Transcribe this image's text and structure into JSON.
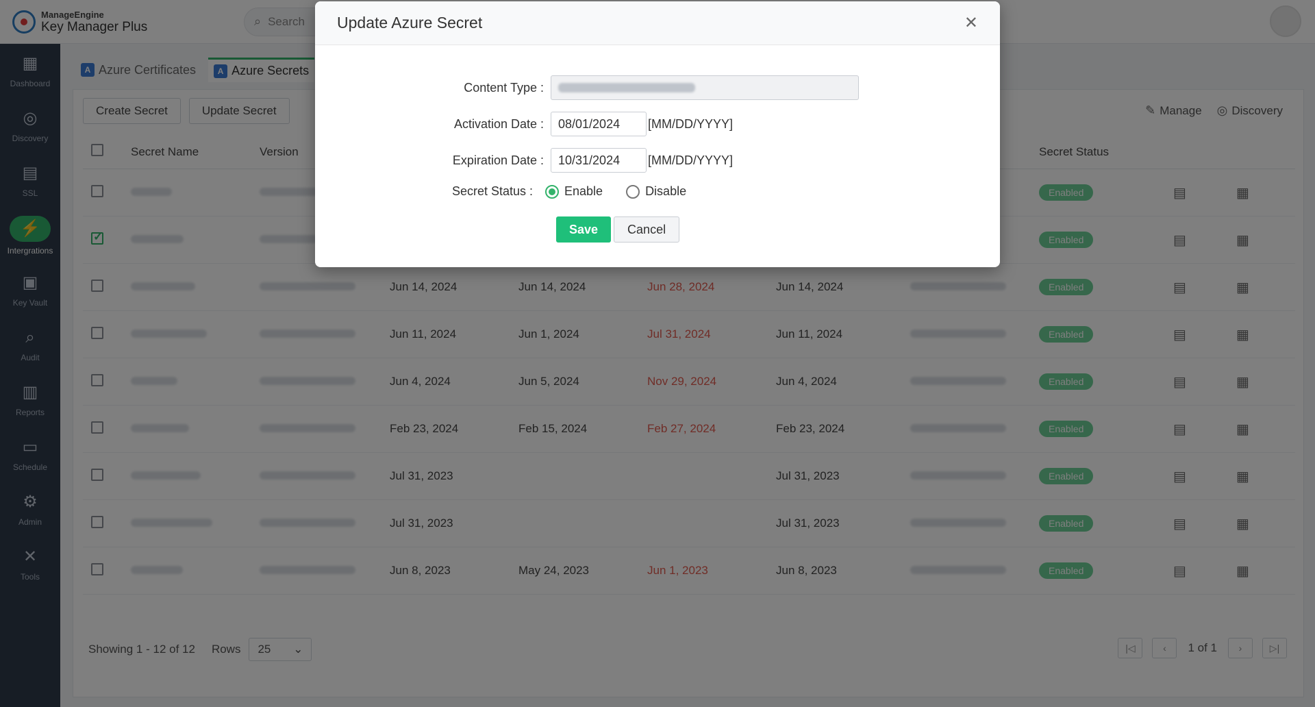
{
  "brand": {
    "small": "ManageEngine",
    "big": "Key Manager Plus"
  },
  "search": {
    "placeholder": "Search"
  },
  "sidebar": {
    "items": [
      {
        "label": "Dashboard",
        "icon": "dashboard-icon"
      },
      {
        "label": "Discovery",
        "icon": "compass-icon"
      },
      {
        "label": "SSL",
        "icon": "certificate-icon"
      },
      {
        "label": "Intergrations",
        "icon": "plug-icon",
        "active": true
      },
      {
        "label": "Key Vault",
        "icon": "vault-icon"
      },
      {
        "label": "Audit",
        "icon": "audit-icon"
      },
      {
        "label": "Reports",
        "icon": "reports-icon"
      },
      {
        "label": "Schedule",
        "icon": "calendar-icon"
      },
      {
        "label": "Admin",
        "icon": "gear-icon"
      },
      {
        "label": "Tools",
        "icon": "tools-icon"
      }
    ]
  },
  "tabs": [
    {
      "label": "Azure Certificates"
    },
    {
      "label": "Azure Secrets"
    }
  ],
  "toolbar": {
    "create_label": "Create Secret",
    "update_label": "Update Secret",
    "manage_label": "Manage",
    "discovery_label": "Discovery"
  },
  "table": {
    "headers": {
      "name": "Secret Name",
      "version": "Version",
      "status": "Secret Status"
    },
    "rows": [
      {
        "d1": "",
        "d2": "",
        "d3": "",
        "d4": "",
        "status": "Enabled",
        "checked": false,
        "tag_suffix": "+..."
      },
      {
        "d1": "",
        "d2": "",
        "d3": "",
        "d4": "",
        "status": "Enabled",
        "checked": true,
        "tag_suffix": "+..."
      },
      {
        "d1": "Jun 14, 2024",
        "d2": "Jun 14, 2024",
        "d3": "Jun 28, 2024",
        "d4": "Jun 14, 2024",
        "status": "Enabled",
        "checked": false
      },
      {
        "d1": "Jun 11, 2024",
        "d2": "Jun 1, 2024",
        "d3": "Jul 31, 2024",
        "d4": "Jun 11, 2024",
        "status": "Enabled",
        "checked": false
      },
      {
        "d1": "Jun 4, 2024",
        "d2": "Jun 5, 2024",
        "d3": "Nov 29, 2024",
        "d4": "Jun 4, 2024",
        "status": "Enabled",
        "checked": false
      },
      {
        "d1": "Feb 23, 2024",
        "d2": "Feb 15, 2024",
        "d3": "Feb 27, 2024",
        "d4": "Feb 23, 2024",
        "status": "Enabled",
        "checked": false
      },
      {
        "d1": "Jul 31, 2023",
        "d2": "",
        "d3": "",
        "d4": "Jul 31, 2023",
        "status": "Enabled",
        "checked": false
      },
      {
        "d1": "Jul 31, 2023",
        "d2": "",
        "d3": "",
        "d4": "Jul 31, 2023",
        "status": "Enabled",
        "checked": false
      },
      {
        "d1": "Jun 8, 2023",
        "d2": "May 24, 2023",
        "d3": "Jun 1, 2023",
        "d4": "Jun 8, 2023",
        "status": "Enabled",
        "checked": false
      }
    ]
  },
  "footer": {
    "showing": "Showing 1 - 12 of 12",
    "rows_label": "Rows",
    "rows_value": "25",
    "page_info": "1 of 1"
  },
  "modal": {
    "title": "Update Azure Secret",
    "content_type_label": "Content Type :",
    "activation_label": "Activation Date :",
    "activation_value": "08/01/2024",
    "expiration_label": "Expiration Date :",
    "expiration_value": "10/31/2024",
    "date_format": "[MM/DD/YYYY]",
    "status_label": "Secret Status :",
    "enable_label": "Enable",
    "disable_label": "Disable",
    "selected_status": "Enable",
    "save_label": "Save",
    "cancel_label": "Cancel"
  },
  "colors": {
    "accent": "#33b36b",
    "save": "#1fbf7a",
    "expired_red": "#e05a4e",
    "sidebar_bg": "#2f3a4a"
  }
}
